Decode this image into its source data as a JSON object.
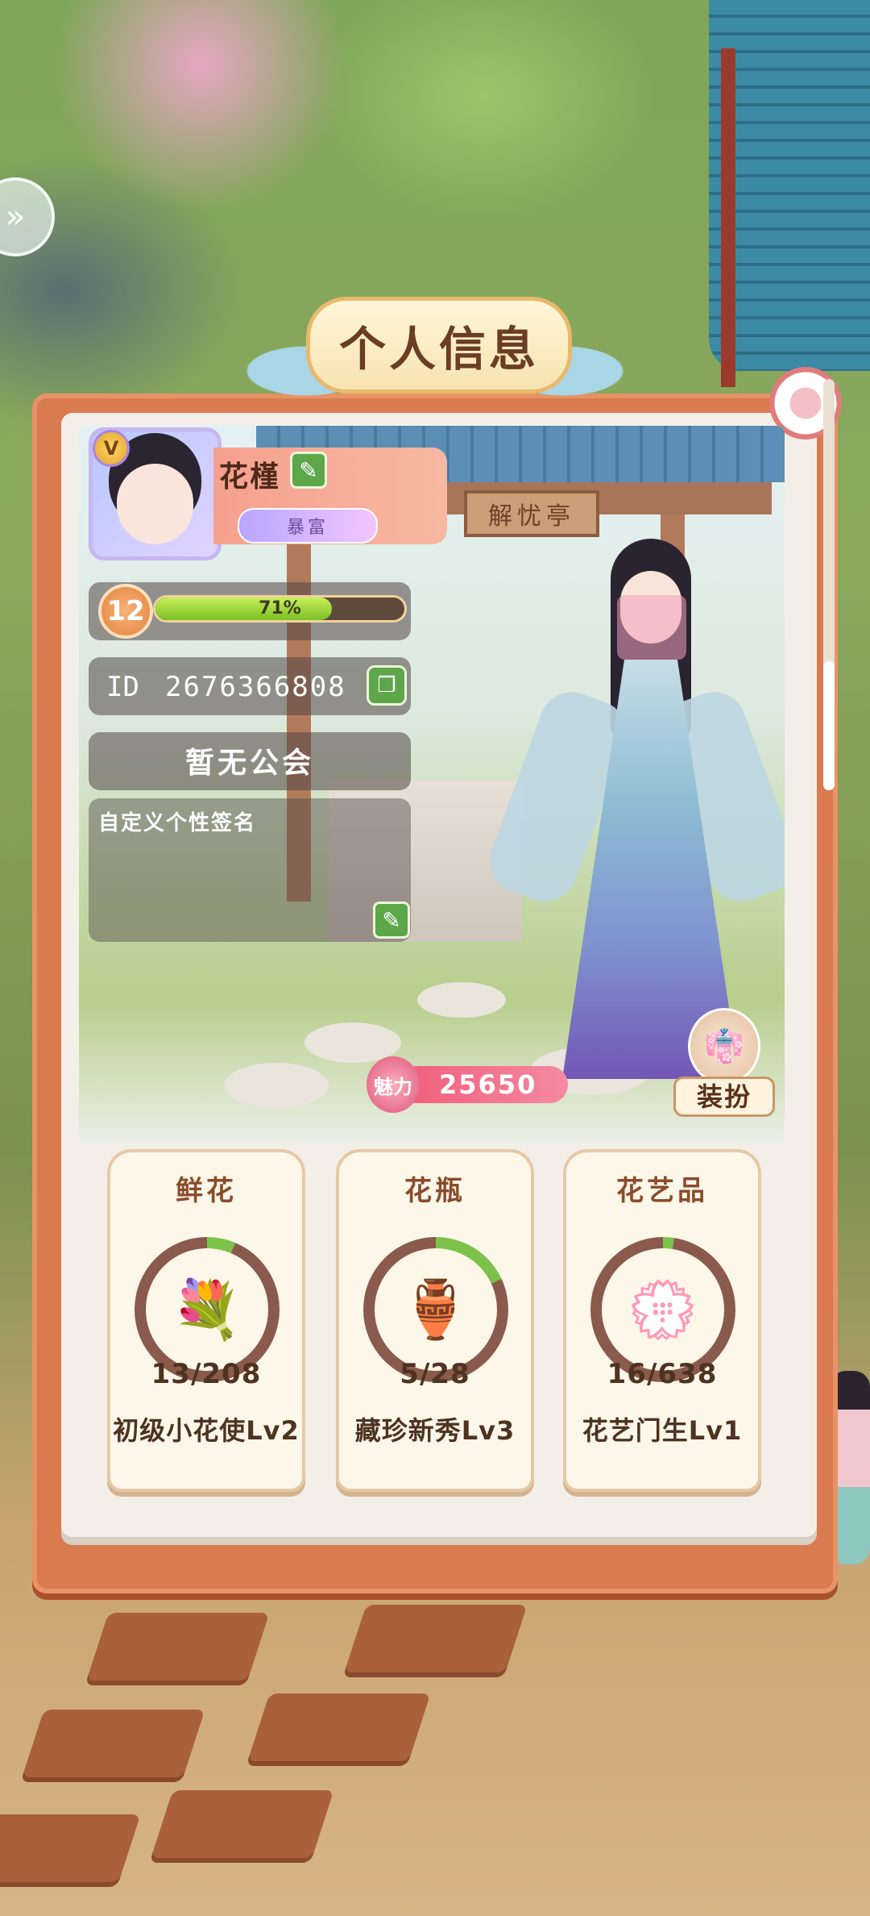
{
  "header": {
    "title": "个人信息"
  },
  "scene": {
    "plaque": "解忧亭"
  },
  "profile": {
    "name": "花槿",
    "vip_badge": "V",
    "title_badge": "暴富",
    "level": "12",
    "xp_percent_label": "71%",
    "xp_fraction": 0.71,
    "id_label": "ID",
    "id_value": "2676366808",
    "guild": "暂无公会",
    "signature_placeholder": "自定义个性签名"
  },
  "charm": {
    "label": "魅力",
    "value": "25650"
  },
  "dress_button": {
    "label": "装扮"
  },
  "collections": [
    {
      "title": "鲜花",
      "count": "13/208",
      "rank": "初级小花使Lv2",
      "progress": 0.0625,
      "icon": "bouquet-icon"
    },
    {
      "title": "花瓶",
      "count": "5/28",
      "rank": "藏珍新秀Lv3",
      "progress": 0.18,
      "icon": "vase-icon"
    },
    {
      "title": "花艺品",
      "count": "16/638",
      "rank": "花艺门生Lv1",
      "progress": 0.025,
      "icon": "flower-arrangement-icon"
    }
  ],
  "colors": {
    "panel_orange": "#d97a4f",
    "button_green": "#5da64a",
    "ring_track": "#8a5a4c",
    "ring_fill": "#7cc24a",
    "charm_pink": "#f05d7a"
  }
}
